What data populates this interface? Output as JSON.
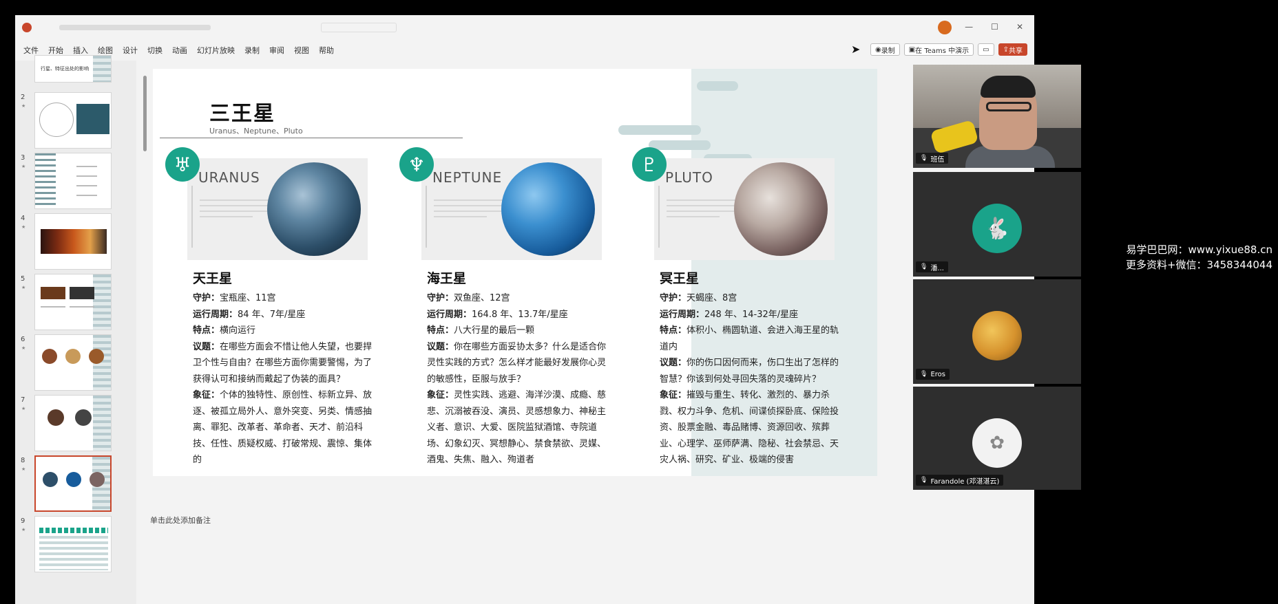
{
  "ribbon": {
    "tabs": [
      "文件",
      "开始",
      "插入",
      "绘图",
      "设计",
      "切换",
      "动画",
      "幻灯片放映",
      "录制",
      "审阅",
      "视图",
      "帮助"
    ],
    "record_label": "录制",
    "teams_label": "在 Teams 中演示",
    "share_label": "共享"
  },
  "thumbnails": {
    "partial_title": "行星、特征出处的影响",
    "numbers": [
      "2",
      "3",
      "4",
      "5",
      "6",
      "7",
      "8",
      "9"
    ],
    "selected": "8"
  },
  "slide": {
    "title": "三王星",
    "subtitle": "Uranus、Neptune、Pluto",
    "planets": [
      {
        "card_name": "URANUS",
        "symbol": "♅",
        "cn_name": "天王星",
        "rows": [
          {
            "label": "守护：",
            "text": "宝瓶座、11宫"
          },
          {
            "label": "运行周期：",
            "text": "84 年、7年/星座"
          },
          {
            "label": "特点：",
            "text": "横向运行"
          },
          {
            "label": "议题：",
            "text": "在哪些方面会不惜让他人失望，也要捍卫个性与自由？在哪些方面你需要警惕，为了获得认可和接纳而戴起了伪装的面具？"
          },
          {
            "label": "象征：",
            "text": "个体的独特性、原创性、标新立异、放逐、被孤立局外人、意外突变、另类、情感抽离、罪犯、改革者、革命者、天才、前沿科技、任性、质疑权威、打破常规、震惊、集体的"
          }
        ]
      },
      {
        "card_name": "NEPTUNE",
        "symbol": "♆",
        "cn_name": "海王星",
        "rows": [
          {
            "label": "守护：",
            "text": "双鱼座、12宫"
          },
          {
            "label": "运行周期：",
            "text": "164.8 年、13.7年/星座"
          },
          {
            "label": "特点：",
            "text": "八大行星的最后一颗"
          },
          {
            "label": "议题：",
            "text": "你在哪些方面妥协太多？什么是适合你灵性实践的方式？怎么样才能最好发展你心灵的敏感性，臣服与放手？"
          },
          {
            "label": "象征：",
            "text": "灵性实践、逃避、海洋沙漠、成瘾、慈悲、沉溺被吞没、演员、灵感想象力、神秘主义者、意识、大爱、医院监狱酒馆、寺院道场、幻象幻灭、冥想静心、禁食禁欲、灵媒、酒鬼、失焦、融入、殉道者"
          }
        ]
      },
      {
        "card_name": "PLUTO",
        "symbol": "♇",
        "cn_name": "冥王星",
        "rows": [
          {
            "label": "守护：",
            "text": "天蝎座、8宫"
          },
          {
            "label": "运行周期：",
            "text": "248 年、14-32年/星座"
          },
          {
            "label": "特点：",
            "text": "体积小、椭圆轨道、会进入海王星的轨道内"
          },
          {
            "label": "议题：",
            "text": "你的伤口因何而来，伤口生出了怎样的智慧？你该到何处寻回失落的灵魂碎片？"
          },
          {
            "label": "象征：",
            "text": "摧毁与重生、转化、激烈的、暴力杀戮、权力斗争、危机、间谍侦探卧底、保险投资、股票金融、毒品赌博、资源回收、殡葬业、心理学、巫师萨满、隐秘、社会禁忌、天灾人祸、研究、矿业、极端的侵害"
          }
        ]
      }
    ]
  },
  "notes_placeholder": "单击此处添加备注",
  "meeting": {
    "participants": [
      {
        "name": "班伍"
      },
      {
        "name": "潘..."
      },
      {
        "name": "Eros"
      },
      {
        "name": "Farandole (邓湛湛云)"
      }
    ]
  },
  "watermark": {
    "line1": "易学巴巴网：www.yixue88.cn",
    "line2": "更多资料+微信：3458344044"
  },
  "colors": {
    "accent": "#1aa38a",
    "office_red": "#c8462b",
    "deco_band": "#e3ecec"
  }
}
